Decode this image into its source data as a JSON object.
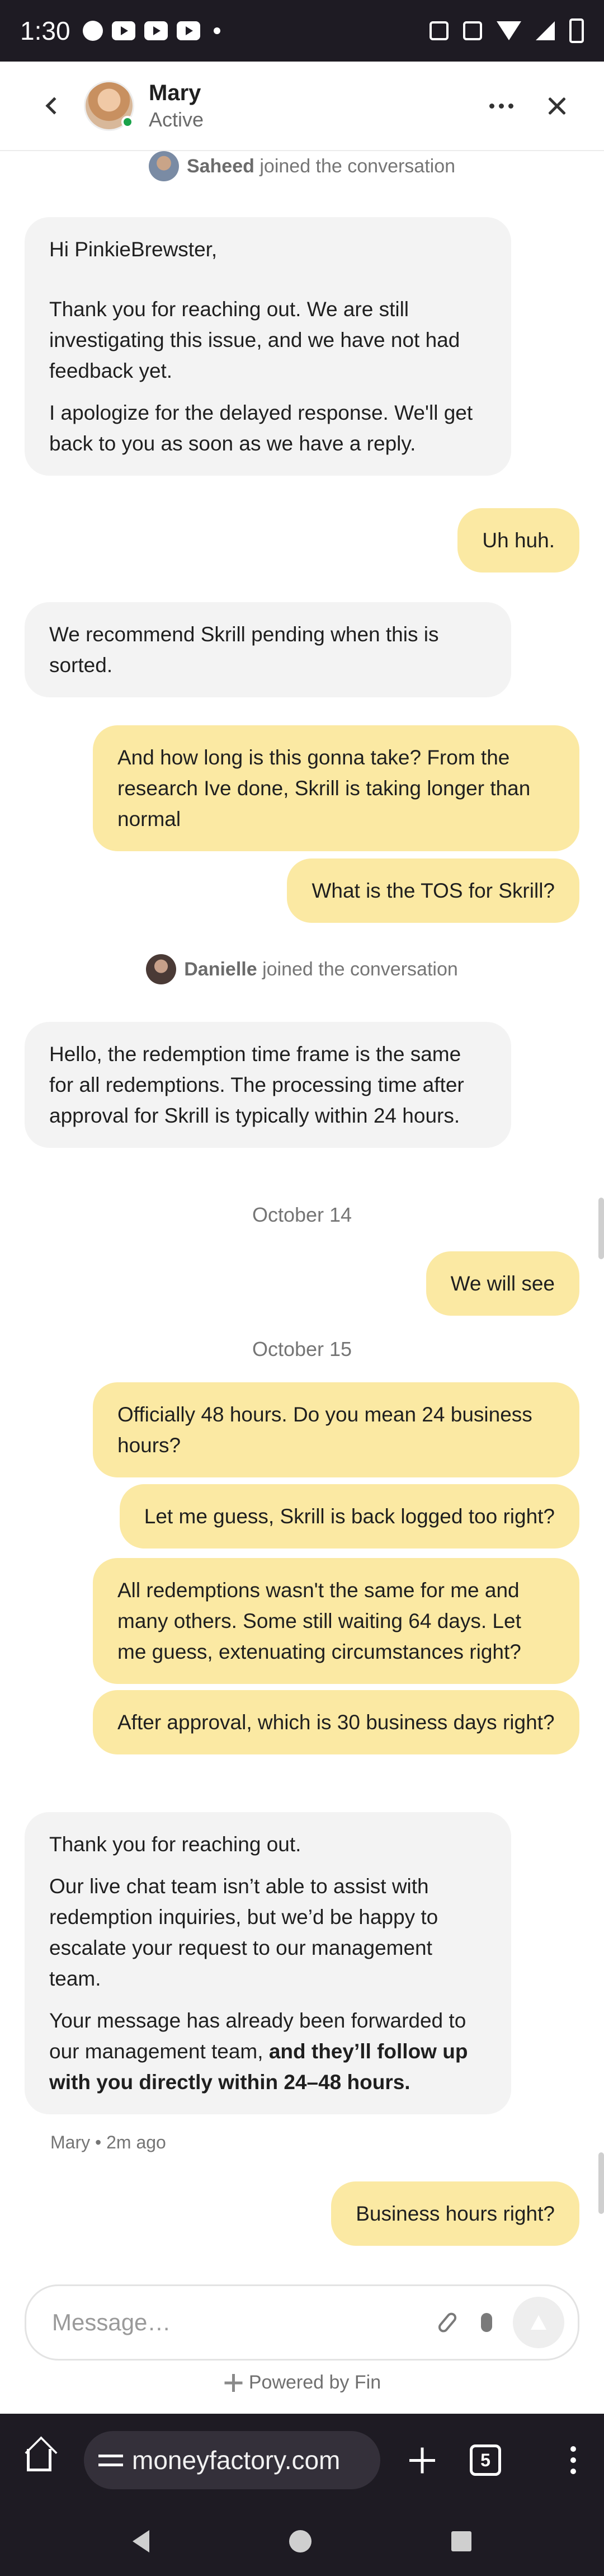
{
  "status_bar": {
    "time": "1:30"
  },
  "header": {
    "agent_name": "Mary",
    "agent_status": "Active"
  },
  "conversation": {
    "join1": {
      "name": "Saheed",
      "text": "joined the conversation"
    },
    "agent_msg1": {
      "p1": "Hi PinkieBrewster,",
      "p2": "Thank you for reaching out. We are still investigating this issue, and we have not had feedback yet.",
      "p3": "I apologize for the delayed response. We'll get back to you as soon as we have a reply."
    },
    "user_msg1": "Uh huh.",
    "agent_msg2": "We recommend Skrill pending when this is sorted.",
    "user_msg2": "And how long is this gonna take? From the research Ive done, Skrill is taking longer than normal",
    "user_msg3": "What is the TOS for Skrill?",
    "join2": {
      "name": "Danielle",
      "text": "joined the conversation"
    },
    "agent_msg3": "Hello, the redemption time frame is the same for all redemptions. The processing time after approval for Skrill is typically within 24 hours.",
    "date1": "October 14",
    "user_msg4": "We will see",
    "date2": "October 15",
    "user_msg5": "Officially 48 hours. Do you mean 24 business hours?",
    "user_msg6": "Let me guess, Skrill is back logged too right?",
    "user_msg7": "All redemptions wasn't the same for me and many others. Some still waiting 64 days. Let me guess, extenuating circumstances right?",
    "user_msg8": "After approval, which is 30 business days right?",
    "agent_msg4": {
      "p1": "Thank you for reaching out.",
      "p2": "Our live chat team isn’t able to assist with redemption inquiries, but we’d be happy to escalate your request to our management team.",
      "p3_plain": "Your message has already been forwarded to our management team, ",
      "p3_bold": "and they’ll follow up with you directly within 24–48 hours."
    },
    "agent_meta": "Mary • 2m ago",
    "user_msg9": "Business hours right?"
  },
  "composer": {
    "placeholder": "Message…"
  },
  "footer": {
    "powered_by": "Powered by Fin"
  },
  "browser": {
    "url": "moneyfactory.com",
    "tab_count": "5"
  },
  "colors": {
    "user_bubble": "#fbe9a3",
    "agent_bubble": "#f3f3f3",
    "online": "#1aa34a",
    "system_bar": "#1e1b23"
  }
}
